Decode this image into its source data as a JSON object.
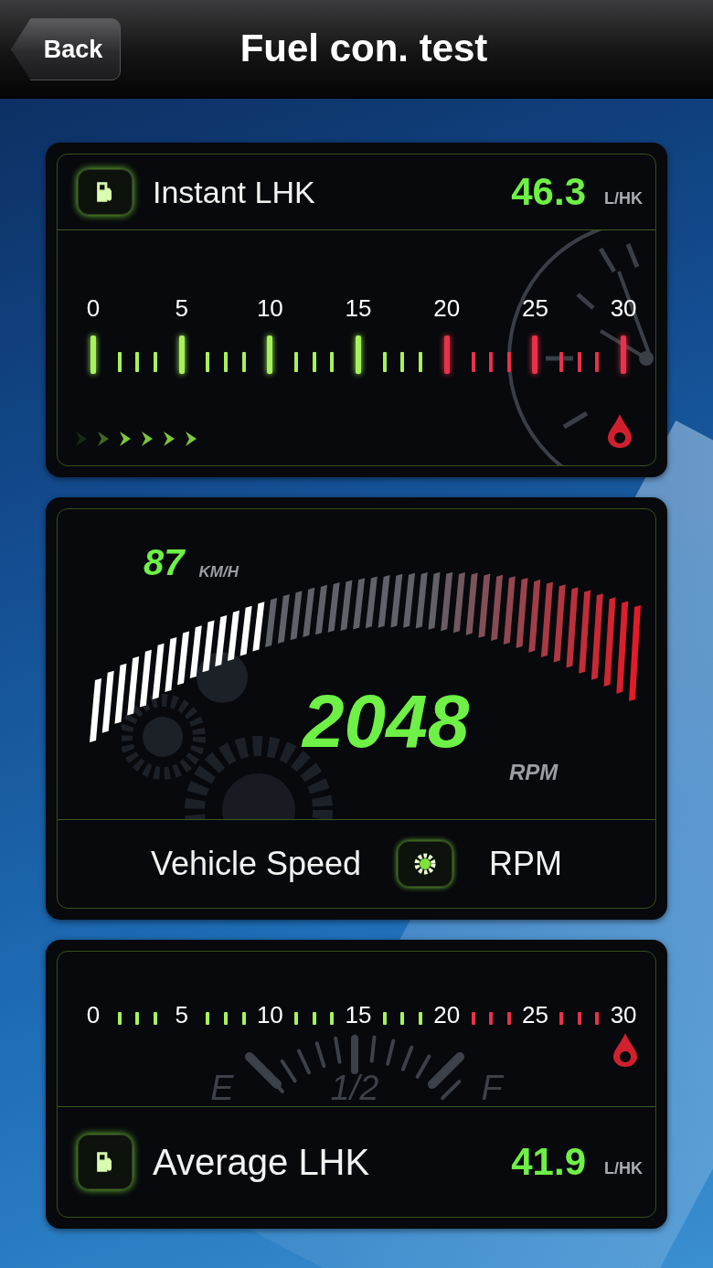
{
  "header": {
    "back_button": "Back",
    "title": "Fuel con. test"
  },
  "instant": {
    "label": "Instant LHK",
    "value": "46.3",
    "unit": "L/HK",
    "scale": [
      {
        "label": "0",
        "color": "#a6f25a"
      },
      {
        "label": "5",
        "color": "#a6f25a"
      },
      {
        "label": "10",
        "color": "#a6f25a"
      },
      {
        "label": "15",
        "color": "#a6f25a"
      },
      {
        "label": "20",
        "color": "#e8314a"
      },
      {
        "label": "25",
        "color": "#e8314a"
      },
      {
        "label": "30",
        "color": "#e8314a"
      }
    ]
  },
  "speed": {
    "value": "87",
    "unit": "KM/H"
  },
  "rpm": {
    "value": "2048",
    "unit": "RPM"
  },
  "mode_bar": {
    "left": "Vehicle Speed",
    "right": "RPM"
  },
  "average": {
    "scale": [
      {
        "label": "0"
      },
      {
        "label": "5"
      },
      {
        "label": "10"
      },
      {
        "label": "15"
      },
      {
        "label": "20"
      },
      {
        "label": "25"
      },
      {
        "label": "30"
      }
    ],
    "tick_groups": [
      {
        "color": "#a6f25a"
      },
      {
        "color": "#a6f25a"
      },
      {
        "color": "#a6f25a"
      },
      {
        "color": "#a6f25a"
      },
      {
        "color": "#e8314a"
      },
      {
        "color": "#e8314a"
      }
    ],
    "gauge_labels": [
      "E",
      "1/2",
      "F"
    ],
    "label": "Average LHK",
    "value": "41.9",
    "unit": "L/HK"
  }
}
